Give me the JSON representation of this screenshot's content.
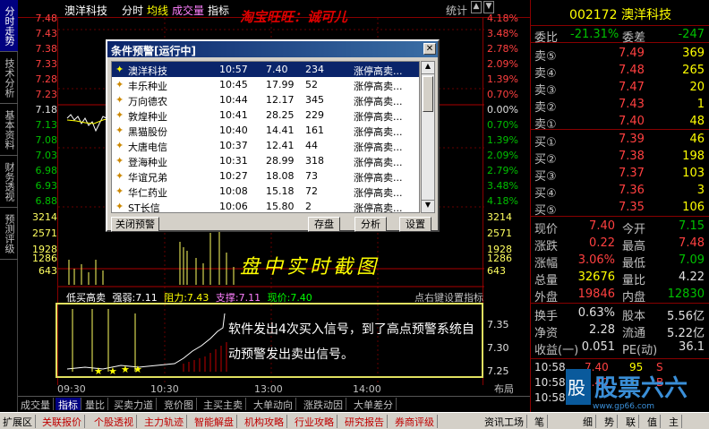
{
  "left_tabs": [
    "分时走势",
    "技术分析",
    "基本资料",
    "财务透视",
    "预测评级"
  ],
  "topbar": {
    "stock_name": "澳洋科技",
    "mode": "分时",
    "avg_line": "均线",
    "volume": "成交量",
    "indicator": "指标",
    "stat": "统计",
    "watermark": "淘宝旺旺：诚可儿"
  },
  "price_axis_left": [
    "7.48",
    "7.43",
    "7.38",
    "7.33",
    "7.28",
    "7.23",
    "7.18",
    "7.13",
    "7.08",
    "7.03",
    "6.98",
    "6.93",
    "6.88"
  ],
  "price_axis_right": [
    "4.18%",
    "3.48%",
    "2.78%",
    "2.09%",
    "1.39%",
    "0.70%",
    "0.00%",
    "0.70%",
    "1.39%",
    "2.09%",
    "2.79%",
    "3.48%",
    "4.18%"
  ],
  "vol_axis_left": [
    "3214",
    "2571",
    "1928",
    "1286",
    "643"
  ],
  "vol_axis_right": [
    "3214",
    "2571",
    "1928",
    "1286",
    "643"
  ],
  "dialog": {
    "title": "条件预警[运行中]",
    "rows": [
      {
        "name": "澳洋科技",
        "time": "10:57",
        "price": "7.40",
        "vol": "234",
        "signal": "涨停高卖..."
      },
      {
        "name": "丰乐种业",
        "time": "10:45",
        "price": "17.99",
        "vol": "52",
        "signal": "涨停高卖..."
      },
      {
        "name": "万向德农",
        "time": "10:44",
        "price": "12.17",
        "vol": "345",
        "signal": "涨停高卖..."
      },
      {
        "name": "敦煌种业",
        "time": "10:41",
        "price": "28.25",
        "vol": "229",
        "signal": "涨停高卖..."
      },
      {
        "name": "黑猫股份",
        "time": "10:40",
        "price": "14.41",
        "vol": "161",
        "signal": "涨停高卖..."
      },
      {
        "name": "大唐电信",
        "time": "10:37",
        "price": "12.41",
        "vol": "44",
        "signal": "涨停高卖..."
      },
      {
        "name": "登海种业",
        "time": "10:31",
        "price": "28.99",
        "vol": "318",
        "signal": "涨停高卖..."
      },
      {
        "name": "华谊兄弟",
        "time": "10:27",
        "price": "18.08",
        "vol": "73",
        "signal": "涨停高卖..."
      },
      {
        "name": "华仁药业",
        "time": "10:08",
        "price": "15.18",
        "vol": "72",
        "signal": "涨停高卖..."
      },
      {
        "name": "ST长信",
        "time": "10:06",
        "price": "15.80",
        "vol": "2",
        "signal": "涨停高卖..."
      }
    ],
    "close_btn": "关闭预警",
    "save_btn": "存盘",
    "analyze_btn": "分析",
    "settings_btn": "设置"
  },
  "indicator_line": {
    "name": "低买高卖",
    "strength": "强弱:7.11",
    "resistance": "阻力:7.43",
    "support": "支撑:7.11",
    "price": "现价:7.40",
    "hint": "点右键设置指标"
  },
  "indicator_axis": [
    "7.35",
    "7.30",
    "7.25"
  ],
  "time_axis": [
    "09:30",
    "10:30",
    "13:00",
    "14:00"
  ],
  "layout_label": "布局",
  "annotation_overlay": "盘中实时截图",
  "annotation_text": "软件发出4次买入信号，到了高点预警系统自动预警发出卖出信号。",
  "right_panel": {
    "code": "002172",
    "name": "澳洋科技",
    "weibi_label": "委比",
    "weibi": "-21.31%",
    "weicha_label": "委差",
    "weicha": "-247",
    "asks": [
      {
        "l": "卖⑤",
        "p": "7.49",
        "v": "369"
      },
      {
        "l": "卖④",
        "p": "7.48",
        "v": "265"
      },
      {
        "l": "卖③",
        "p": "7.47",
        "v": "20"
      },
      {
        "l": "卖②",
        "p": "7.43",
        "v": "1"
      },
      {
        "l": "卖①",
        "p": "7.40",
        "v": "48"
      }
    ],
    "bids": [
      {
        "l": "买①",
        "p": "7.39",
        "v": "46"
      },
      {
        "l": "买②",
        "p": "7.38",
        "v": "198"
      },
      {
        "l": "买③",
        "p": "7.37",
        "v": "103"
      },
      {
        "l": "买④",
        "p": "7.36",
        "v": "3"
      },
      {
        "l": "买⑤",
        "p": "7.35",
        "v": "106"
      }
    ],
    "stats": [
      {
        "a": "现价",
        "av": "7.40",
        "b": "今开",
        "bv": "7.15"
      },
      {
        "a": "涨跌",
        "av": "0.22",
        "b": "最高",
        "bv": "7.48"
      },
      {
        "a": "涨幅",
        "av": "3.06%",
        "b": "最低",
        "bv": "7.09"
      },
      {
        "a": "总量",
        "av": "32676",
        "b": "量比",
        "bv": "4.22"
      },
      {
        "a": "外盘",
        "av": "19846",
        "b": "内盘",
        "bv": "12830"
      }
    ],
    "stats2": [
      {
        "a": "换手",
        "av": "0.63%",
        "b": "股本",
        "bv": "5.56亿"
      },
      {
        "a": "净资",
        "av": "2.28",
        "b": "流通",
        "bv": "5.22亿"
      },
      {
        "a": "收益(一)",
        "av": "0.051",
        "b": "PE(动)",
        "bv": "36.1"
      }
    ],
    "ticks": [
      {
        "t": "10:58",
        "p": "7.40",
        "v": "95",
        "d": "S"
      },
      {
        "t": "10:58",
        "p": "7.40",
        "v": "1",
        "d": "B"
      },
      {
        "t": "10:58",
        "p": "",
        "v": "",
        "d": ""
      }
    ]
  },
  "bottom_tabs": [
    "成交量",
    "指标",
    "量比",
    "买卖力道",
    "竞价图",
    "主买主卖",
    "大单动向",
    "涨跌动因",
    "大单差分"
  ],
  "status_bar": [
    "扩展区",
    "关联报价",
    "个股透视",
    "主力轨迹",
    "智能解盘",
    "机构攻略",
    "行业攻略",
    "研究报告",
    "券商评级",
    "资讯工场",
    "笔",
    "细",
    "势",
    "联",
    "值",
    "主"
  ],
  "logo": {
    "text": "股票六六",
    "url": "www.gp66.com"
  },
  "colors": {
    "up": "#ff4040",
    "down": "#00c000",
    "accent": "#ffff00"
  }
}
